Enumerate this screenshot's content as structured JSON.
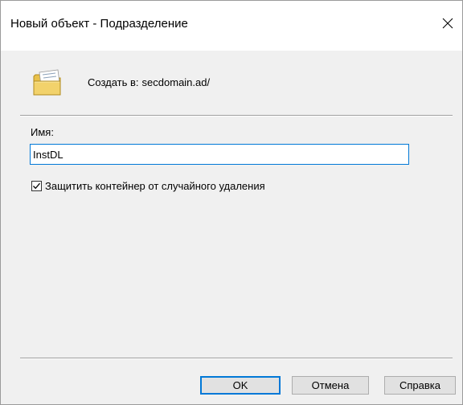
{
  "window": {
    "title": "Новый объект - Подразделение",
    "close_glyph": "✕"
  },
  "header": {
    "icon": "folder-icon",
    "create_in_label": "Создать в:",
    "create_in_path": "secdomain.ad/"
  },
  "form": {
    "name_label": "Имя:",
    "name_value": "InstDL",
    "protect_label": "Защитить контейнер от случайного удаления",
    "protect_checked": true
  },
  "buttons": {
    "ok": "OK",
    "cancel": "Отмена",
    "help": "Справка"
  },
  "colors": {
    "accent": "#0078d7",
    "background": "#f0f0f0",
    "folder": "#f2d26b"
  }
}
